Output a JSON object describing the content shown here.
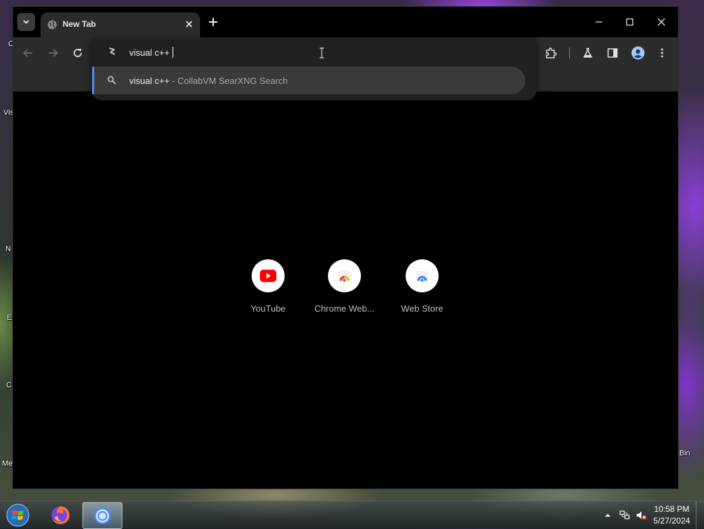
{
  "desktop": {
    "side_labels": [
      "C",
      "Vis",
      "N",
      "E",
      "C",
      "Me",
      "Bin"
    ]
  },
  "tab": {
    "title": "New Tab",
    "close_icon": "close-icon",
    "favicon": "globe-icon"
  },
  "window_controls": [
    "minimize-icon",
    "maximize-icon",
    "close-icon"
  ],
  "toolbar": {
    "back_icon": "arrow-left-icon",
    "forward_icon": "arrow-right-icon",
    "reload_icon": "reload-icon",
    "extensions_icon": "puzzle-icon",
    "labs_icon": "flask-icon",
    "side_panel_icon": "side-panel-icon",
    "profile_icon": "avatar-icon",
    "menu_icon": "kebab-menu-icon"
  },
  "omnibox": {
    "input_text": "visual c++",
    "suggestion": {
      "query": "visual c++",
      "separator": " - ",
      "description": "CollabVM SearXNG Search"
    }
  },
  "shortcuts": [
    {
      "label": "YouTube",
      "icon": "youtube-icon"
    },
    {
      "label": "Chrome Web...",
      "icon": "chrome-web-store-icon"
    },
    {
      "label": "Web Store",
      "icon": "web-store-icon"
    }
  ],
  "taskbar": {
    "pinned": [
      "windows-start-icon",
      "firefox-icon",
      "chrome-icon"
    ],
    "tray": [
      "chevron-up-icon",
      "network-icon",
      "volume-muted-icon"
    ],
    "time": "10:58 PM",
    "date": "5/27/2024"
  },
  "colors": {
    "accent": "#4a8cff",
    "youtube_red": "#ff0000",
    "toolbar_bg": "#2b2b2b",
    "page_bg": "#000000"
  }
}
